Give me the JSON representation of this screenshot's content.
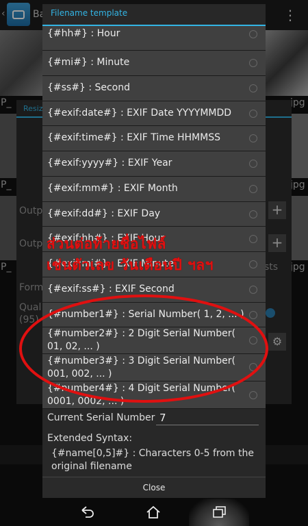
{
  "background": {
    "app_title": "Ba",
    "thumb_labels": [
      "P_",
      "P_",
      "P_"
    ],
    "thumb_ext": [
      "jpg",
      "jpg",
      "jpg"
    ],
    "dialog_title": "Resiz",
    "side_labels": [
      "Outp",
      "Outp",
      "Form",
      "Qual",
      "(95)"
    ],
    "side_right_text": "sts"
  },
  "dialog": {
    "title": "Filename template",
    "items": [
      {
        "label": "{#hh#} : Hour"
      },
      {
        "label": "{#mi#} : Minute"
      },
      {
        "label": "{#ss#} : Second"
      },
      {
        "label": "{#exif:date#} : EXIF Date YYYYMMDD"
      },
      {
        "label": "{#exif:time#} : EXIF Time HHMMSS"
      },
      {
        "label": "{#exif:yyyy#} : EXIF Year"
      },
      {
        "label": "{#exif:mm#} : EXIF Month"
      },
      {
        "label": "{#exif:dd#} : EXIF Day"
      },
      {
        "label": "{#exif:hh#} : EXIF Hour"
      },
      {
        "label": "{#exif:mi#} : EXIF Minute"
      },
      {
        "label": "{#exif:ss#} : EXIF Second"
      },
      {
        "label": "{#number1#} : Serial Number( 1, 2, ... )"
      },
      {
        "label": "{#number2#} : 2 Digit Serial Number( 01, 02, ... )"
      },
      {
        "label": "{#number3#} : 3 Digit Serial Number( 001, 002, ... )"
      },
      {
        "label": "{#number4#} : 4 Digit Serial Number( 0001, 0002, ... )"
      }
    ],
    "current_serial_label": "Current Serial Number",
    "current_serial_value": "7",
    "extended_syntax_label": "Extended Syntax:",
    "extended_syntax_desc": "{#name[0,5]#} : Characters 0-5 from the original filename",
    "close_label": "Close"
  },
  "annotation": {
    "line1": "ส่วนต่อท้ายชื่อไฟล์",
    "line2": "เช่นตัวเลข วันเดือนปี ฯลฯ",
    "color": "#e01010"
  },
  "navbar": {
    "icons": [
      "back-icon",
      "home-icon",
      "recent-apps-icon"
    ]
  }
}
